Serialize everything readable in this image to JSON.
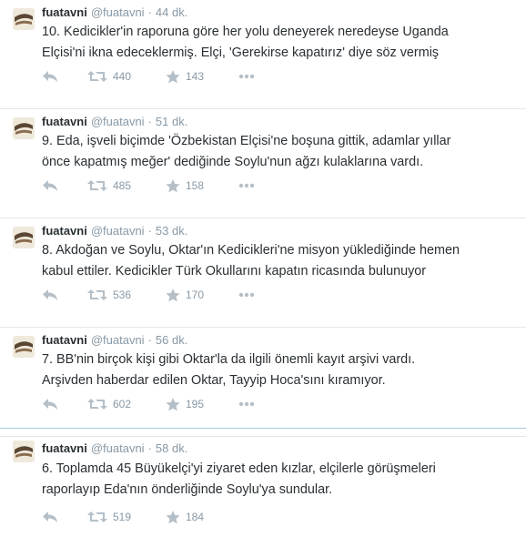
{
  "colors": {
    "accent": "#292f33",
    "muted": "#8899a6",
    "divider": "#e1e8ed",
    "icon": "#b5bfc7"
  },
  "icons": {
    "reply": "reply-icon",
    "retweet": "retweet-icon",
    "favorite": "star-icon",
    "more": "more-icon"
  },
  "tweets": [
    {
      "fullname": "fuatavni",
      "screen_name": "@fuatavni",
      "separator": "·",
      "time": "44 dk.",
      "line1": "10. Kedicikler'in raporuna göre her yolu deneyerek neredeyse Uganda",
      "line2": "Elçisi'ni ikna edeceklermiş. Elçi, 'Gerekirse kapatırız' diye söz vermiş",
      "retweets": "440",
      "favorites": "143"
    },
    {
      "fullname": "fuatavni",
      "screen_name": "@fuatavni",
      "separator": "·",
      "time": "51 dk.",
      "line1": "9. Eda, işveli biçimde 'Özbekistan Elçisi'ne boşuna gittik, adamlar yıllar",
      "line2": "önce kapatmış meğer' dediğinde Soylu'nun ağzı kulaklarına vardı.",
      "retweets": "485",
      "favorites": "158"
    },
    {
      "fullname": "fuatavni",
      "screen_name": "@fuatavni",
      "separator": "·",
      "time": "53 dk.",
      "line1": "8. Akdoğan ve Soylu, Oktar'ın Kedicikleri'ne misyon yüklediğinde hemen",
      "line2": "kabul ettiler. Kedicikler Türk Okullarını kapatın ricasında bulunuyor",
      "retweets": "536",
      "favorites": "170"
    },
    {
      "fullname": "fuatavni",
      "screen_name": "@fuatavni",
      "separator": "·",
      "time": "56 dk.",
      "line1": "7. BB'nin birçok kişi gibi Oktar'la da ilgili önemli kayıt arşivi vardı.",
      "line2": "Arşivden haberdar edilen Oktar, Tayyip Hoca'sını kıramıyor.",
      "retweets": "602",
      "favorites": "195"
    },
    {
      "fullname": "fuatavni",
      "screen_name": "@fuatavni",
      "separator": "·",
      "time": "58 dk.",
      "line1": "6. Toplamda 45 Büyükelçi'yi ziyaret eden kızlar, elçilerle görüşmeleri",
      "line2": "raporlayıp Eda'nın önderliğinde Soylu'ya sundular.",
      "retweets": "519",
      "favorites": "184"
    }
  ]
}
